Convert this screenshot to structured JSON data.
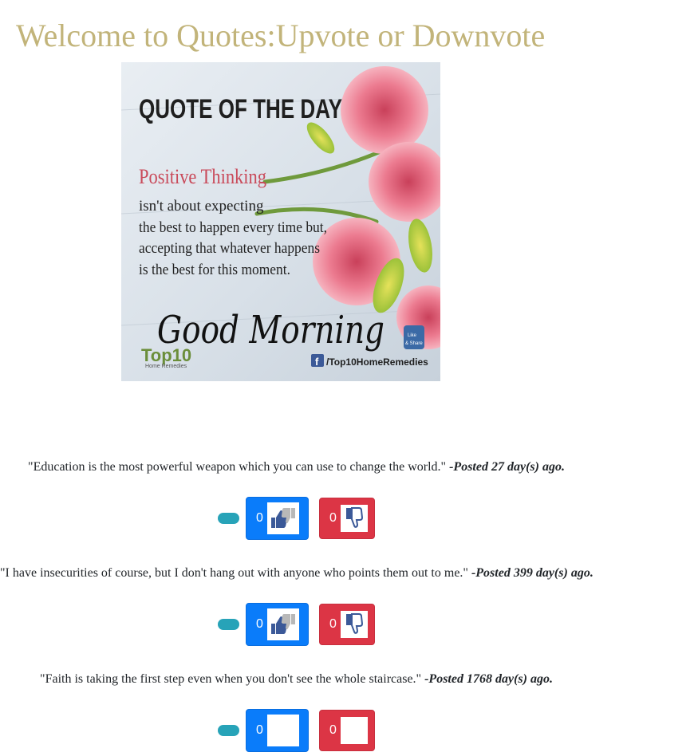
{
  "page": {
    "title": "Welcome to Quotes:Upvote or Downvote"
  },
  "hero_image": {
    "heading": "QUOTE OF THE DAY",
    "subheading": "Positive Thinking",
    "lines": [
      "isn't about expecting",
      "the best to happen every time but,",
      "accepting that whatever happens",
      "is the best for this moment."
    ],
    "greeting": "Good Morning",
    "brand": "Top10",
    "brand_tagline": "Home Remedies",
    "social_handle": "/Top10HomeRemedies",
    "badge_top": "Like",
    "badge_bottom": "& Share"
  },
  "quotes": [
    {
      "text": "\"Education is the most powerful weapon which you can use to change the world.\"",
      "posted": "-Posted 27 day(s) ago.",
      "upvotes": "0",
      "downvotes": "0"
    },
    {
      "text": "\"I have insecurities of course, but I don't hang out with anyone who points them out to me.\"",
      "posted": "-Posted 399 day(s) ago.",
      "upvotes": "0",
      "downvotes": "0"
    },
    {
      "text": "\"Faith is taking the first step even when you don't see the whole staircase.\"",
      "posted": "-Posted 1768 day(s) ago.",
      "upvotes": "0",
      "downvotes": "0"
    }
  ],
  "icons": {
    "upvote": "thumbs-up-down-icon",
    "downvote": "thumbs-down-icon",
    "toggle": "pill-toggle"
  },
  "colors": {
    "title": "#c2b47a",
    "upvote_button": "#0a7cfa",
    "downvote_button": "#dc3545",
    "pill": "#27a3b8",
    "text": "#212529"
  }
}
